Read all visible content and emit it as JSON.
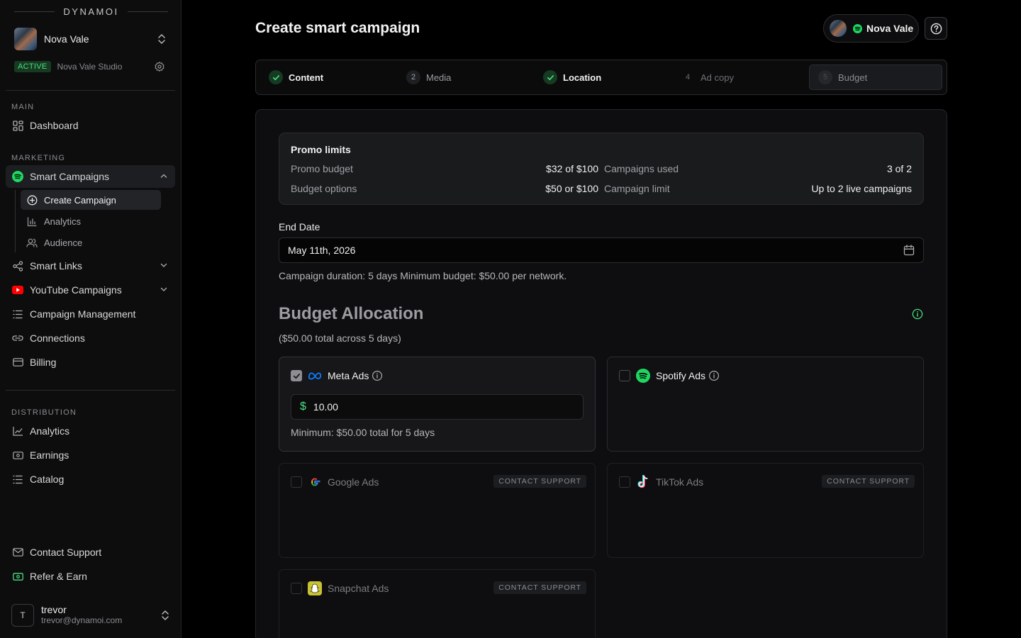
{
  "sidebar": {
    "brand": "DYNAMOI",
    "artist": {
      "name": "Nova Vale",
      "status": "ACTIVE",
      "studio": "Nova Vale Studio"
    },
    "sections": {
      "main": "MAIN",
      "marketing": "MARKETING",
      "distribution": "DISTRIBUTION"
    },
    "main_items": [
      {
        "label": "Dashboard",
        "icon": "grid-icon"
      }
    ],
    "marketing_items": [
      {
        "label": "Smart Campaigns",
        "icon": "spotify-icon"
      },
      {
        "label": "Smart Links",
        "icon": "share-icon"
      },
      {
        "label": "YouTube Campaigns",
        "icon": "youtube-icon"
      },
      {
        "label": "Campaign Management",
        "icon": "list-icon"
      },
      {
        "label": "Connections",
        "icon": "link-icon"
      },
      {
        "label": "Billing",
        "icon": "card-icon"
      }
    ],
    "smart_campaigns_sub": [
      {
        "label": "Create Campaign",
        "icon": "plus-circle-icon"
      },
      {
        "label": "Analytics",
        "icon": "bar-chart-icon"
      },
      {
        "label": "Audience",
        "icon": "users-icon"
      }
    ],
    "distribution_items": [
      {
        "label": "Analytics",
        "icon": "line-chart-icon"
      },
      {
        "label": "Earnings",
        "icon": "money-icon"
      },
      {
        "label": "Catalog",
        "icon": "list-icon"
      }
    ],
    "footer_items": [
      {
        "label": "Contact Support",
        "icon": "mail-icon"
      },
      {
        "label": "Refer & Earn",
        "icon": "gift-icon"
      }
    ],
    "user": {
      "initial": "T",
      "name": "trevor",
      "email": "trevor@dynamoi.com"
    }
  },
  "header": {
    "title": "Create smart campaign",
    "artist_chip": "Nova Vale"
  },
  "steps": [
    {
      "label": "Content",
      "state": "done",
      "num": "1"
    },
    {
      "label": "Media",
      "state": "pending",
      "num": "2"
    },
    {
      "label": "Location",
      "state": "done",
      "num": "3"
    },
    {
      "label": "Ad copy",
      "state": "dim",
      "num": "4"
    },
    {
      "label": "Budget",
      "state": "current",
      "num": "5"
    }
  ],
  "limits": {
    "title": "Promo limits",
    "promo_budget_label": "Promo budget",
    "promo_budget_value": "$32 of $100",
    "budget_options_label": "Budget options",
    "budget_options_value": "$50 or $100",
    "campaigns_used_label": "Campaigns used",
    "campaigns_used_value": "3 of 2",
    "campaign_limit_label": "Campaign limit",
    "campaign_limit_value": "Up to 2 live campaigns"
  },
  "end_date": {
    "label": "End Date",
    "value": "May 11th, 2026",
    "note": "Campaign duration: 5 days Minimum budget: $50.00 per network."
  },
  "budget": {
    "title": "Budget Allocation",
    "subtitle": "($50.00 total across 5 days)",
    "networks": [
      {
        "name": "Meta Ads",
        "checked": true,
        "amount": "10.00",
        "min_note": "Minimum: $50.00 total for 5 days"
      },
      {
        "name": "Spotify Ads",
        "checked": false
      },
      {
        "name": "Google Ads",
        "checked": false,
        "support": "CONTACT SUPPORT"
      },
      {
        "name": "TikTok Ads",
        "checked": false,
        "support": "CONTACT SUPPORT"
      },
      {
        "name": "Snapchat Ads",
        "checked": false,
        "support": "CONTACT SUPPORT"
      }
    ]
  },
  "colors": {
    "accent_green": "#4ade80",
    "spotify_green": "#1ed760",
    "youtube_red": "#ff0000",
    "meta_blue": "#0a7cff"
  }
}
